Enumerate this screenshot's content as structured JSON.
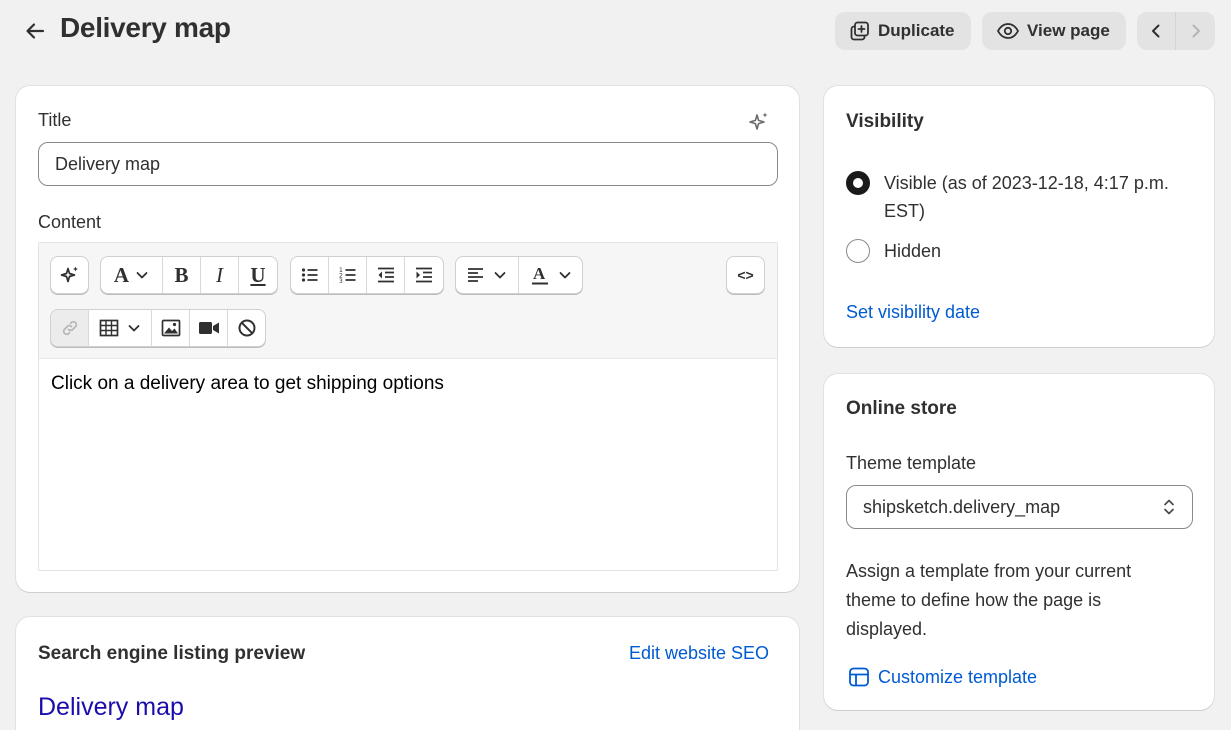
{
  "header": {
    "title": "Delivery map",
    "duplicate_label": "Duplicate",
    "view_page_label": "View page"
  },
  "main": {
    "title_label": "Title",
    "title_value": "Delivery map",
    "content_label": "Content",
    "editor_text": "Click on a delivery area to get shipping options",
    "code_label": "<>"
  },
  "seo": {
    "heading": "Search engine listing preview",
    "edit_link": "Edit website SEO",
    "preview_title": "Delivery map"
  },
  "visibility": {
    "heading": "Visibility",
    "options": [
      {
        "label": "Visible (as of 2023-12-18, 4:17 p.m. EST)",
        "selected": true
      },
      {
        "label": "Hidden",
        "selected": false
      }
    ],
    "set_date_link": "Set visibility date"
  },
  "online_store": {
    "heading": "Online store",
    "template_label": "Theme template",
    "template_value": "shipsketch.delivery_map",
    "help_text": "Assign a template from your current theme to define how the page is displayed.",
    "customize_link": "Customize template"
  },
  "colors": {
    "link": "#005bd3",
    "seo_title": "#1a0dab",
    "background": "#f1f1f1"
  }
}
